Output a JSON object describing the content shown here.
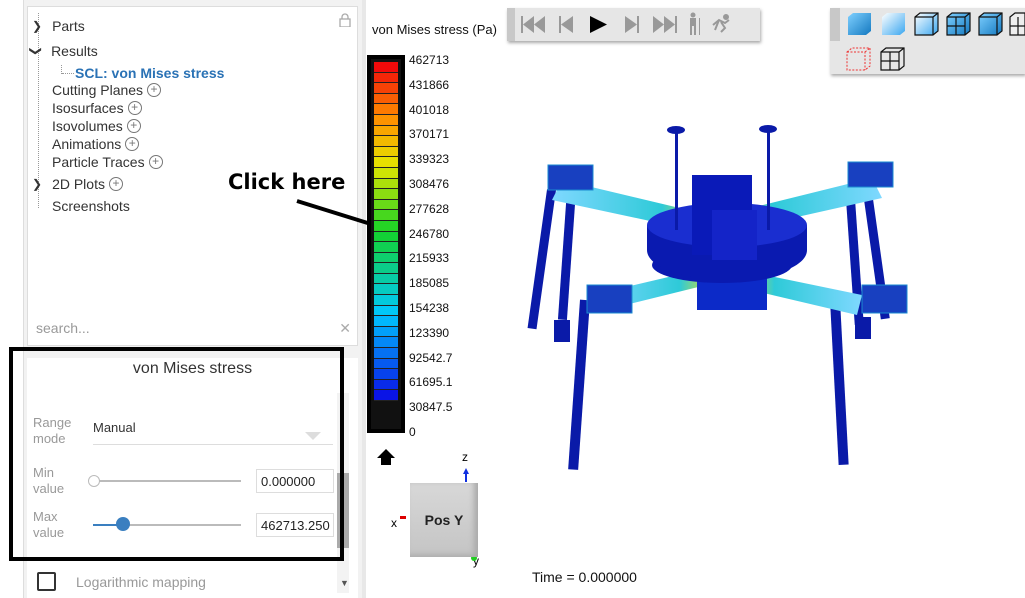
{
  "tree": {
    "items": [
      {
        "label": "Parts",
        "expander": "collapsed"
      },
      {
        "label": "Results",
        "expander": "expanded"
      },
      {
        "label": "SCL: von Mises stress",
        "selected": true
      },
      {
        "label": "Cutting Planes",
        "add": true
      },
      {
        "label": "Isosurfaces",
        "add": true
      },
      {
        "label": "Isovolumes",
        "add": true
      },
      {
        "label": "Animations",
        "add": true
      },
      {
        "label": "Particle Traces",
        "add": true
      },
      {
        "label": "2D Plots",
        "add": true,
        "expander": "collapsed"
      },
      {
        "label": "Screenshots"
      }
    ],
    "search_placeholder": "search...",
    "lock_icon": "lock-icon"
  },
  "panel": {
    "title": "von Mises stress",
    "range_mode_label": "Range mode",
    "range_mode_value": "Manual",
    "min_label": "Min value",
    "min_value": "0.000000",
    "min_slider_fraction": 0,
    "max_label": "Max value",
    "max_value": "462713.250",
    "max_slider_fraction": 0.2,
    "log_label": "Logarithmic mapping",
    "log_checked": false
  },
  "annotation": {
    "text": "Click here"
  },
  "legend": {
    "title": "von Mises stress (Pa)",
    "labels": [
      "462713",
      "431866",
      "401018",
      "370171",
      "339323",
      "308476",
      "277628",
      "246780",
      "215933",
      "185085",
      "154238",
      "123390",
      "92542.7",
      "61695.1",
      "30847.5",
      "0"
    ],
    "colormap": "blue-cyan-green-yellow-red"
  },
  "playback": {
    "buttons": [
      "first",
      "previous",
      "play",
      "next",
      "last",
      "walk",
      "run"
    ]
  },
  "view_toolbar": {
    "buttons": [
      "shaded",
      "shaded-light",
      "shaded-outline",
      "shaded-mesh",
      "shaded-edges",
      "mesh-hidden",
      "wireframe-points",
      "wireframe-mesh"
    ]
  },
  "orientation": {
    "face_label": "Pos Y",
    "axes": {
      "x": "x",
      "y": "y",
      "z": "z"
    }
  },
  "status": {
    "time": "Time = 0.000000"
  }
}
